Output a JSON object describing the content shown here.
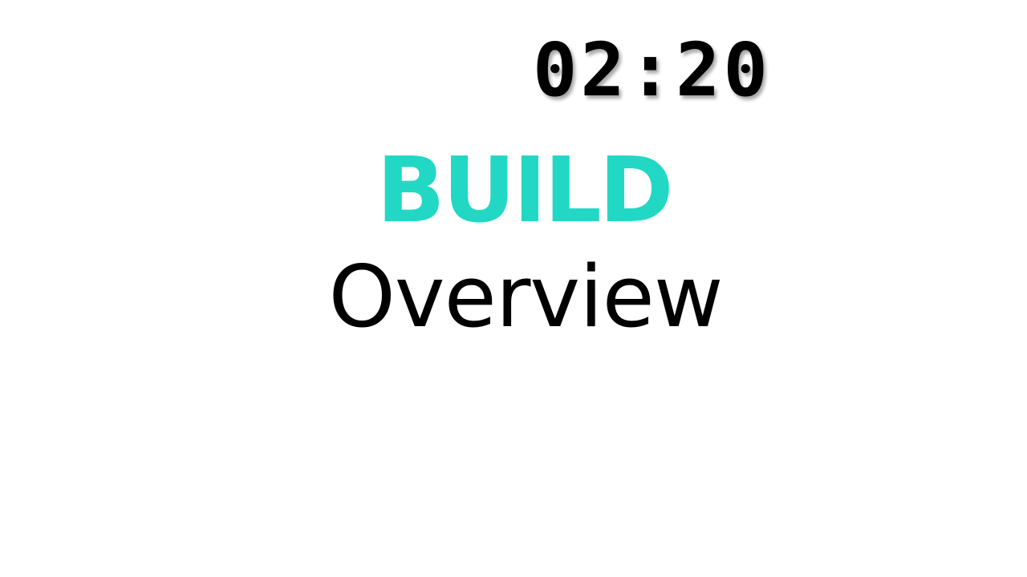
{
  "timer": {
    "value": "02:20"
  },
  "slide": {
    "title": "BUILD",
    "subtitle": "Overview",
    "title_color": "#22d8c4",
    "subtitle_color": "#000000"
  }
}
